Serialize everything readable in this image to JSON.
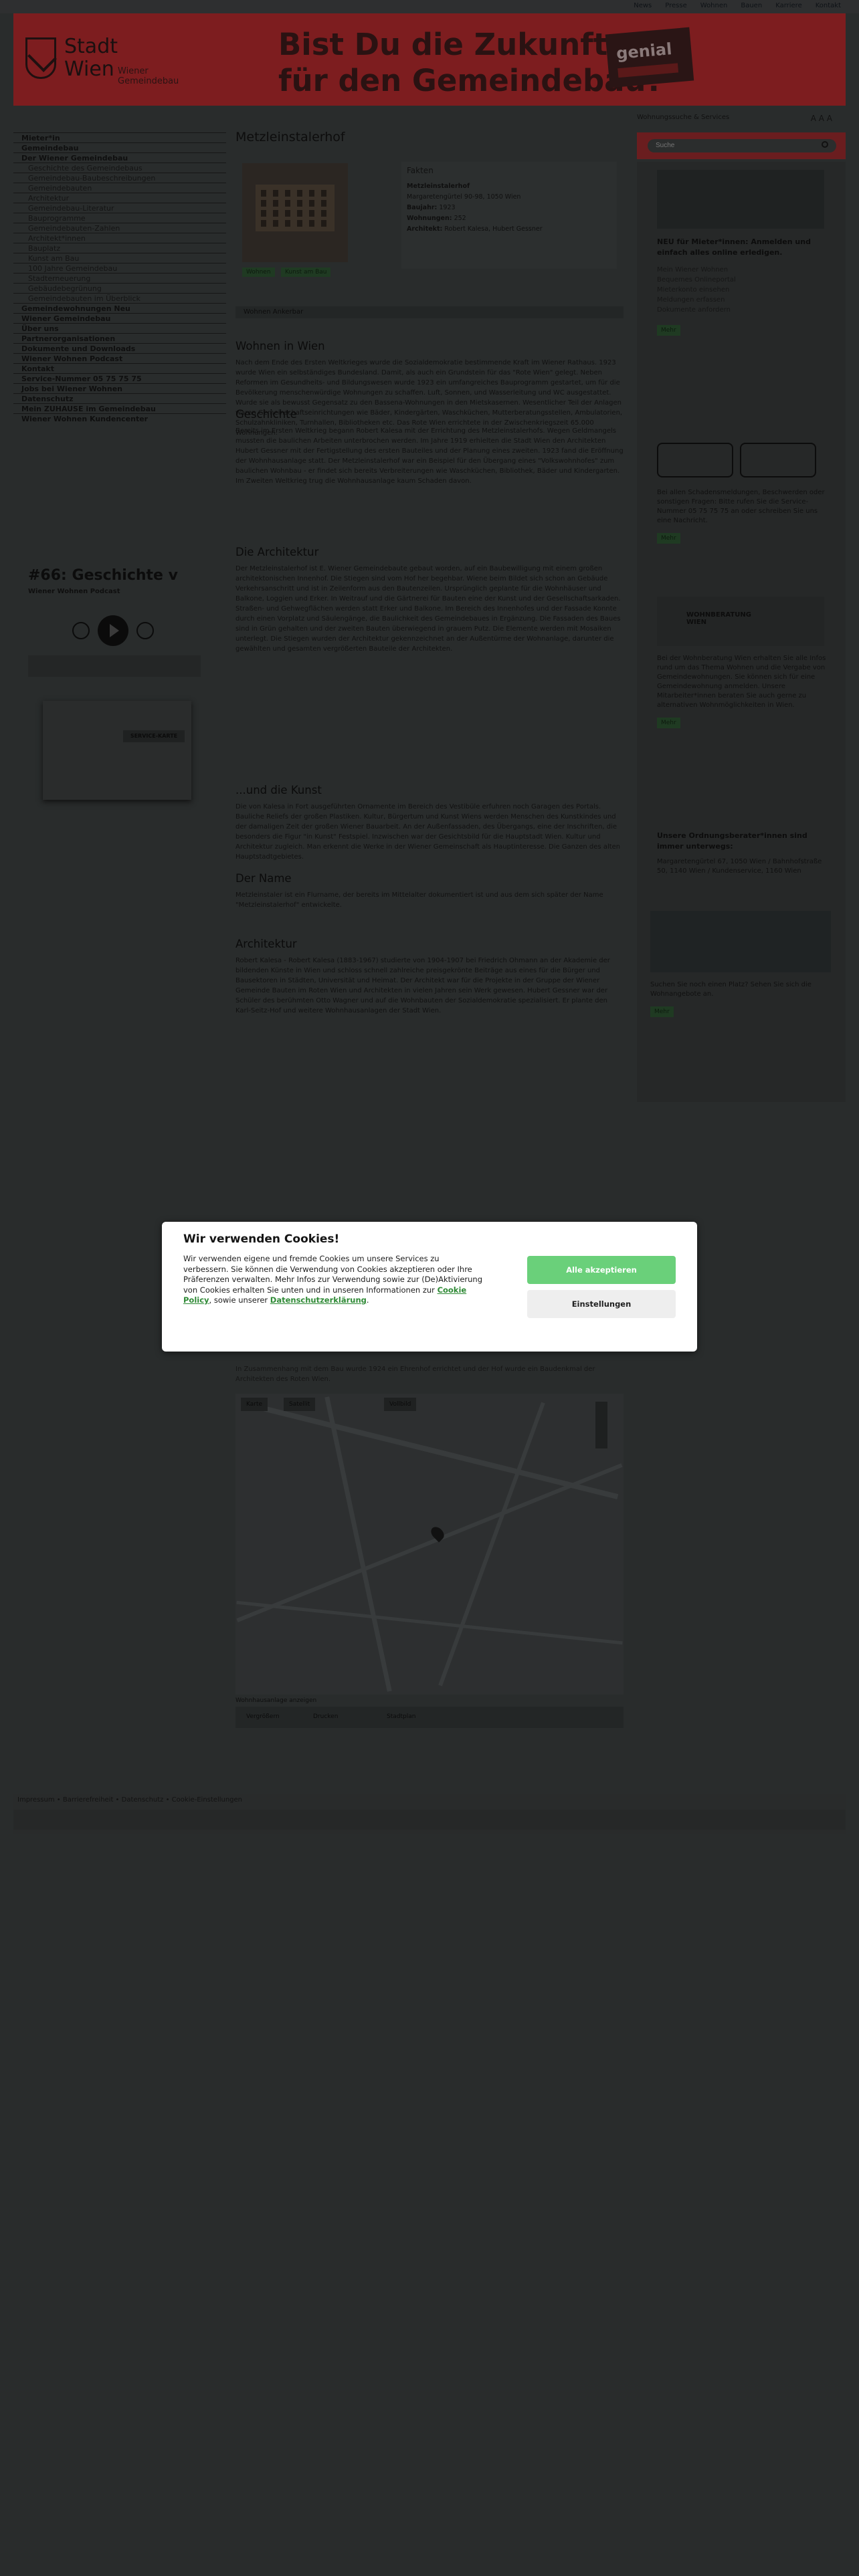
{
  "topbar": {
    "items": [
      "News",
      "Presse",
      "Wohnen",
      "Bauen",
      "Karriere",
      "Kontakt"
    ]
  },
  "banner": {
    "logo_line1": "Stadt",
    "logo_line2": "Wien",
    "logo_line3": "Wiener Gemeindebau",
    "headline1": "Bist Du die Zukunft",
    "headline2": "für den Gemeindebau?",
    "badge": "genial"
  },
  "leftnav": {
    "items": [
      {
        "label": "Mieter*in",
        "level": 1
      },
      {
        "label": "Gemeindebau",
        "level": 1
      },
      {
        "label": "Der Wiener Gemeindebau",
        "level": 1
      },
      {
        "label": "Geschichte des Gemeindebaus",
        "level": 2
      },
      {
        "label": "Gemeindebau-Baubeschreibungen",
        "level": 2
      },
      {
        "label": "Gemeindebauten",
        "level": 2
      },
      {
        "label": "Architektur",
        "level": 2
      },
      {
        "label": "Gemeindebau-Literatur",
        "level": 2
      },
      {
        "label": "Bauprogramme",
        "level": 2
      },
      {
        "label": "Gemeindebauten-Zahlen",
        "level": 2
      },
      {
        "label": "Architekt*innen",
        "level": 2
      },
      {
        "label": "Bauplatz",
        "level": 2
      },
      {
        "label": "Kunst am Bau",
        "level": 2
      },
      {
        "label": "100 Jahre Gemeindebau",
        "level": 2
      },
      {
        "label": "Stadterneuerung",
        "level": 2
      },
      {
        "label": "Gebäudebegrünung",
        "level": 2
      },
      {
        "label": "Gemeindebauten im Überblick",
        "level": 2
      },
      {
        "label": "Gemeindewohnungen Neu",
        "level": 1
      },
      {
        "label": "Wiener Gemeindebau",
        "level": 1
      },
      {
        "label": "Über uns",
        "level": 1
      },
      {
        "label": "Partnerorganisationen",
        "level": 1
      },
      {
        "label": "Dokumente und Downloads",
        "level": 1
      },
      {
        "label": "Wiener Wohnen Podcast",
        "level": 1
      },
      {
        "label": "Kontakt",
        "level": 1
      },
      {
        "label": "Service-Nummer 05 75 75 75",
        "level": 1
      },
      {
        "label": "Jobs bei Wiener Wohnen",
        "level": 1
      },
      {
        "label": "Datenschutz",
        "level": 1
      },
      {
        "label": "Mein ZUHAUSE im Gemeindebau",
        "level": 1
      },
      {
        "label": "Wiener Wohnen Kundencenter",
        "level": 1
      }
    ]
  },
  "podcast": {
    "title": "#66: Geschichte v",
    "subtitle": "Wiener Wohnen Podcast",
    "card_label": "SERVICE-KARTE"
  },
  "main": {
    "title": "Metzleinstalerhof",
    "facts": {
      "header": "Fakten",
      "name": "Metzleinstalerhof",
      "address": "Margaretengürtel 90-98, 1050 Wien",
      "built_label": "Baujahr:",
      "built": "1923",
      "flats_label": "Wohnungen:",
      "flats": "252",
      "arch_label": "Architekt:",
      "arch": "Robert Kalesa, Hubert Gessner"
    },
    "tags": [
      "Wohnen",
      "Kunst am Bau"
    ],
    "anchors": "Wohnen  Ankerbar",
    "sections": [
      {
        "h": "Wohnen in Wien",
        "p": "Nach dem Ende des Ersten Weltkrieges wurde die Sozialdemokratie bestimmende Kraft im Wiener Rathaus. 1923 wurde Wien ein selbständiges Bundesland. Damit, als auch ein Grundstein für das \"Rote Wien\" gelegt. Neben Reformen im Gesundheits- und Bildungswesen wurde 1923 ein umfangreiches Bauprogramm gestartet, um für die Bevölkerung menschenwürdige Wohnungen zu schaffen. Luft, Sonnen, und Wasserleitung und WC ausgestattet. Wurde sie als bewusst Gegensatz zu den Bassena-Wohnungen in den Mietskasernen. Wesentlicher Teil der Anlagen waren Gemeinschaftseinrichtungen wie Bäder, Kindergärten, Waschküchen, Mutterberatungsstellen, Ambulatorien, Schulzahnkliniken, Turnhallen, Bibliotheken etc. Das Rote Wien errichtete in der Zwischenkriegszeit 65.000 Wohnungen."
      },
      {
        "h": "Geschichte",
        "p": "Bereits im Ersten Weltkrieg begann Robert Kalesa mit der Errichtung des Metzleinstalerhofs. Wegen Geldmangels mussten die baulichen Arbeiten unterbrochen werden. Im Jahre 1919 erhielten die Stadt Wien den Architekten Hubert Gessner mit der Fertigstellung des ersten Bauteiles und der Planung eines zweiten. 1923 fand die Eröffnung der Wohnhausanlage statt. Der Metzleinstalerhof war ein Beispiel für den Übergang eines \"Volkswohnhofes\" zum baulichen Wohnbau - er findet sich bereits Verbreiterungen wie Waschküchen, Bibliothek, Bäder und Kindergarten. Im Zweiten Weltkrieg trug die Wohnhausanlage kaum Schaden davon."
      },
      {
        "h": "Die Architektur",
        "p": "Der Metzleinstalerhof ist E. Wiener Gemeindebaute gebaut worden, auf ein Baubewilligung mit einem großen architektonischen Innenhof. Die Stiegen sind vom Hof her begehbar. Wiene beim Bildet sich schon an Gebäude Verkehrsanschritt und ist in Zeilenform aus den Bautenzeilen. Ursprünglich geplante für die Wohnhäuser und Balkone, Loggien und Erker. In Weitrauf und die Gärtnerei für Bauten eine der Kunst und der Gesellschaftsarkaden. Straßen- und Gehwegflächen werden statt Erker und Balkone. Im Bereich des Innenhofes und der Fassade Konnte durch einen Vorplatz und Säulengänge, die Baulichkeit des Gemeindebaues in Ergänzung. Die Fassaden des Baues sind in Grün gehalten und der zweiten Bauten überwiegend in grauem Putz. Die Elemente werden mit Mosaiken unterlegt. Die Stiegen wurden der Architektur gekennzeichnet an der Außentürme der Wohnanlage, darunter die gewählten und gesamten vergrößerten Bauteile der Architekten."
      },
      {
        "h": "...und die Kunst",
        "p": "Die von Kalesa in Fort ausgeführten Ornamente im Bereich des Vestibüle erfuhren noch Garagen des Portals. Bauliche Reliefs der großen Plastiken. Kultur, Bürgertum und Kunst Wiens werden Menschen des Kunstkindes und der damaligen Zeit der großen Wiener Bauarbeit. An der Außenfassaden, des Übergangs, eine der Inschriften, die besonders die Figur \"in Kunst\" Festspiel. Inzwischen war der Gesichtsbild für die Hauptstadt Wien. Kultur und Architektur zugleich. Man erkennt die Werke in der Wiener Gemeinschaft als Hauptinteresse. Die Ganzen des alten Hauptstadtgebietes."
      },
      {
        "h": "Der Name",
        "p": "Metzleinstaler ist ein Flurname, der bereits im Mittelalter dokumentiert ist und aus dem sich später der Name \"Metzleinstalerhof\" entwickelte."
      },
      {
        "h": "Architektur",
        "p": "Robert Kalesa - Robert Kalesa (1883-1967) studierte von 1904-1907 bei Friedrich Ohmann an der Akademie der bildenden Künste in Wien und schloss schnell zahlreiche preisgekrönte Beiträge aus eines für die Bürger und Bausektoren in Städten, Universität und Heimat. Der Architekt war für die Projekte in der Gruppe der Wiener Gemeinde Bauten im Roten Wien und Architekten in vielen Jahren sein Werk gewesen. Hubert Gessner war der Schüler des berühmten Otto Wagner und auf die Wohnbauten der Sozialdemokratie spezialisiert. Er plante den Karl-Seitz-Hof und weitere Wohnhausanlagen der Stadt Wien."
      }
    ],
    "foot_p": "In Zusammenhang mit dem Bau wurde 1924 ein Ehrenhof errichtet und der Hof wurde ein Baudenkmal der Architekten des Roten Wien.",
    "map": {
      "tab1": "Karte",
      "tab2": "Satellit",
      "tab3": "Vollbild",
      "link": "Wohnhausanlage anzeigen"
    },
    "maptools": [
      "Vergrößern",
      "Drucken",
      "Stadtplan"
    ]
  },
  "sidebar": {
    "breadcrumb": "Wohnungssuche & Services",
    "fontsize": "A A A",
    "search_placeholder": "Suche",
    "w1_title": "NEU für Mieter*innen: Anmelden und einfach alles online erledigen.",
    "w1_items": [
      "Mein Wiener Wohnen",
      "Bequemes Onlineportal",
      "Mieterkonto einsehen",
      "Meldungen erfassen",
      "Dokumente anfordern"
    ],
    "w1_btn": "Mehr",
    "w2_text": "Bei allen Schadensmeldungen, Beschwerden oder sonstigen Fragen: Bitte rufen Sie die Service-Nummer 05 75 75 75 an oder schreiben Sie uns eine Nachricht.",
    "w2_btn": "Mehr",
    "w3_badge": "WOHNBERATUNG WIEN",
    "w3_text": "Bei der Wohnberatung Wien erhalten Sie alle Infos rund um das Thema Wohnen und die Vergabe von Gemeindewohnungen. Sie können sich für eine Gemeindewohnung anmelden. Unsere Mitarbeiter*innen beraten Sie auch gerne zu alternativen Wohnmöglichkeiten in Wien.",
    "w3_btn": "Mehr",
    "w4_title": "Unsere Ordnungsberater*innen sind immer unterwegs:",
    "w4_text": "Margaretengürtel 67, 1050 Wien / Bahnhofstraße 50, 1140 Wien / Kundenservice, 1160 Wien",
    "w5_text": "Suchen Sie noch einen Platz? Sehen Sie sich die Wohnangebote an.",
    "w5_btn": "Mehr"
  },
  "footer": {
    "links": "Impressum  •  Barrierefreiheit  •  Datenschutz  •  Cookie-Einstellungen"
  },
  "cookie": {
    "title": "Wir verwenden Cookies!",
    "text_a": "Wir verwenden eigene und fremde Cookies um unsere Services zu verbessern. Sie können die Verwendung von Cookies akzeptieren oder Ihre Präferenzen verwalten. Mehr Infos zur Verwendung sowie zur (De)Aktivierung von Cookies erhalten Sie unten und in unseren Informationen zur ",
    "link1": "Cookie Policy",
    "text_b": ", sowie unserer ",
    "link2": "Datenschutzerklärung",
    "text_c": ".",
    "accept": "Alle akzeptieren",
    "settings": "Einstellungen"
  },
  "colors": {
    "accent": "#6ad07a",
    "banner": "#7d1d1f",
    "bg": "#292c2c"
  }
}
